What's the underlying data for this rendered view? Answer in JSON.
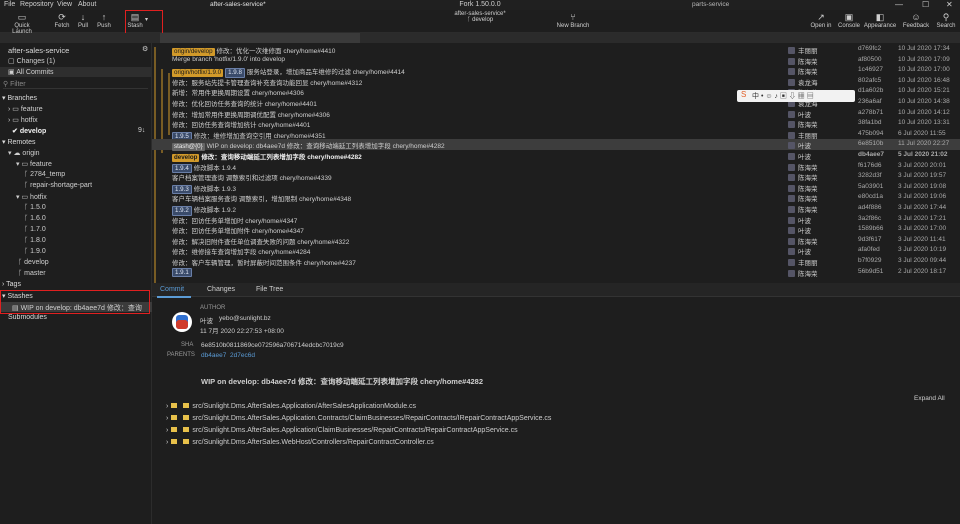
{
  "menu": [
    "File",
    "Repository",
    "View",
    "About"
  ],
  "title": "Fork 1.50.0.0",
  "window_controls": [
    "—",
    "☐",
    "✕"
  ],
  "toolbar": {
    "quick_launch": "Quick Launch",
    "fetch": "Fetch",
    "pull": "Pull",
    "push": "Push",
    "stash": "Stash",
    "repo_name": "after-sales-service*",
    "branch": "develop",
    "new_branch": "New Branch",
    "open_in": "Open in",
    "console": "Console",
    "appearance": "Appearance",
    "feedback": "Feedback",
    "search": "Search"
  },
  "tabs": [
    "after-sales-service*",
    "parts-service"
  ],
  "sidebar": {
    "repo": "after-sales-service",
    "changes": "Changes (1)",
    "all_commits": "All Commits",
    "filter": "Filter",
    "branches": "Branches",
    "feature": "feature",
    "hotfix": "hotfix",
    "develop": "develop",
    "develop_badge": "9↓",
    "remotes": "Remotes",
    "origin": "origin",
    "r_feature": "feature",
    "f1": "2784_temp",
    "f2": "repair-shortage-part",
    "r_hotfix": "hotfix",
    "h1": "1.5.0",
    "h2": "1.6.0",
    "h3": "1.7.0",
    "h4": "1.8.0",
    "h5": "1.9.0",
    "r_develop": "develop",
    "r_master": "master",
    "tags": "Tags",
    "stashes": "Stashes",
    "stash_item": "WIP on develop: db4aee7d 修改：查询",
    "submodules": "Submodules"
  },
  "commits": [
    {
      "tags": [
        {
          "t": "origin/develop",
          "k": "branch"
        }
      ],
      "msg": "修改：优化一次维修面 chery/home#4410",
      "author": "丰丽丽",
      "sha": "d769fc2",
      "date": "10 Jul 2020 17:34",
      "bold": false,
      "sel": false
    },
    {
      "tags": [],
      "msg": "Merge branch 'hotfix/1.9.0' into develop",
      "author": "陈海荣",
      "sha": "af80500",
      "date": "10 Jul 2020 17:09",
      "bold": false,
      "sel": false
    },
    {
      "tags": [
        {
          "t": "origin/hotfix/1.9.0",
          "k": "branch"
        },
        {
          "t": "1.9.8",
          "k": "ver"
        }
      ],
      "msg": "服务站登录，增加商品车维修的过滤 chery/home#4414",
      "author": "陈海荣",
      "sha": "1c46927",
      "date": "10 Jul 2020 17:00",
      "bold": false,
      "sel": false
    },
    {
      "tags": [],
      "msg": "修改：服务站先提卡管理查询补充查询功能回显 chery/home#4312",
      "author": "袁龙海",
      "sha": "802afc5",
      "date": "10 Jul 2020 16:48",
      "bold": false,
      "sel": false
    },
    {
      "tags": [],
      "msg": "新增：常用件更换周期设置 chery/home#4306",
      "author": "陈海荣",
      "sha": "d1a602b",
      "date": "10 Jul 2020 15:21",
      "bold": false,
      "sel": false
    },
    {
      "tags": [],
      "msg": "修改：优化回访任务查询的统计 chery/home#4401",
      "author": "袁龙海",
      "sha": "236a6af",
      "date": "10 Jul 2020 14:38",
      "bold": false,
      "sel": false
    },
    {
      "tags": [],
      "msg": "修改：增加常用件更换周期调优配置 chery/home#4306",
      "author": "叶波",
      "sha": "a278b71",
      "date": "10 Jul 2020 14:12",
      "bold": false,
      "sel": false
    },
    {
      "tags": [],
      "msg": "修改：回访任务查询增加统计 chery/home#4401",
      "author": "陈海荣",
      "sha": "38fa1bd",
      "date": "10 Jul 2020 13:31",
      "bold": false,
      "sel": false
    },
    {
      "tags": [
        {
          "t": "1.9.5",
          "k": "ver"
        }
      ],
      "msg": "修改：维修增加查询空引用 chery/home#4351",
      "author": "丰丽丽",
      "sha": "475b094",
      "date": "6 Jul 2020 11:55",
      "bold": false,
      "sel": false
    },
    {
      "tags": [
        {
          "t": "stash@{0}",
          "k": "stash"
        }
      ],
      "msg": "WIP on develop: db4aee7d 修改：查询移动端延工列表增加字段 chery/home#4282",
      "author": "叶波",
      "sha": "6e8510b",
      "date": "11 Jul 2020 22:27",
      "bold": false,
      "sel": true
    },
    {
      "tags": [
        {
          "t": "develop",
          "k": "branch"
        }
      ],
      "msg": "修改：查询移动端延工列表增加字段 chery/home#4282",
      "author": "叶波",
      "sha": "db4aee7",
      "date": "5 Jul 2020 21:02",
      "bold": true,
      "sel": false
    },
    {
      "tags": [
        {
          "t": "1.9.4",
          "k": "ver"
        }
      ],
      "msg": "修改脚本 1.9.4",
      "author": "陈海荣",
      "sha": "f6176d6",
      "date": "3 Jul 2020 20:01",
      "bold": false,
      "sel": false
    },
    {
      "tags": [],
      "msg": "客户档案管理查询 调整索引和过滤项 chery/home#4339",
      "author": "陈海荣",
      "sha": "3282d3f",
      "date": "3 Jul 2020 19:57",
      "bold": false,
      "sel": false
    },
    {
      "tags": [
        {
          "t": "1.9.3",
          "k": "ver"
        }
      ],
      "msg": "修改脚本 1.9.3",
      "author": "陈海荣",
      "sha": "5a03901",
      "date": "3 Jul 2020 19:08",
      "bold": false,
      "sel": false
    },
    {
      "tags": [],
      "msg": "客户车辆档案服务查询 调整索引，增加限制 chery/home#4348",
      "author": "陈海荣",
      "sha": "e80cd1a",
      "date": "3 Jul 2020 19:06",
      "bold": false,
      "sel": false
    },
    {
      "tags": [
        {
          "t": "1.9.2",
          "k": "ver"
        }
      ],
      "msg": "修改脚本 1.9.2",
      "author": "陈海荣",
      "sha": "ad4f886",
      "date": "3 Jul 2020 17:44",
      "bold": false,
      "sel": false
    },
    {
      "tags": [],
      "msg": "修改：回访任务单增加时 chery/home#4347",
      "author": "叶波",
      "sha": "3a2f86c",
      "date": "3 Jul 2020 17:21",
      "bold": false,
      "sel": false
    },
    {
      "tags": [],
      "msg": "修改：回访任务单增加附件 chery/home#4347",
      "author": "叶波",
      "sha": "1589b66",
      "date": "3 Jul 2020 17:00",
      "bold": false,
      "sel": false
    },
    {
      "tags": [],
      "msg": "修改：解决旧附件查任单位调查失败的问题 chery/home#4322",
      "author": "陈海荣",
      "sha": "9d3f617",
      "date": "3 Jul 2020 11:41",
      "bold": false,
      "sel": false
    },
    {
      "tags": [],
      "msg": "修改：维修接车查询增加字段 chery/home#4284",
      "author": "叶波",
      "sha": "afa0fed",
      "date": "3 Jul 2020 10:19",
      "bold": false,
      "sel": false
    },
    {
      "tags": [],
      "msg": "修改：客户车辆管理，暂时屏蔽时间范围条件 chery/home#4237",
      "author": "丰丽丽",
      "sha": "b7f0929",
      "date": "3 Jul 2020 09:44",
      "bold": false,
      "sel": false
    },
    {
      "tags": [
        {
          "t": "1.9.1",
          "k": "ver"
        }
      ],
      "msg": "",
      "author": "陈海荣",
      "sha": "56b9d51",
      "date": "2 Jul 2020 18:17",
      "bold": false,
      "sel": false
    }
  ],
  "details": {
    "tabs": [
      "Commit",
      "Changes",
      "File Tree"
    ],
    "author_label": "AUTHOR",
    "author_name": "叶波",
    "author_email": "yebo@sunlight.bz",
    "author_date": "11 7月 2020 22:27:53 +08:00",
    "sha_label": "SHA",
    "sha": "6e8510b0811869ce072596a706714edcbc7019c9",
    "parents_label": "PARENTS",
    "parent1": "db4aee7",
    "parent2": "2d7ec6d",
    "message": "WIP on develop: db4aee7d 修改：查询移动端延工列表增加字段 chery/home#4282",
    "expand_all": "Expand All",
    "files": [
      "src/Sunlight.Dms.AfterSales.Application/AfterSalesApplicationModule.cs",
      "src/Sunlight.Dms.AfterSales.Application.Contracts/ClaimBusinesses/RepairContracts/IRepairContractAppService.cs",
      "src/Sunlight.Dms.AfterSales.Application/ClaimBusinesses/RepairContracts/RepairContractAppService.cs",
      "src/Sunlight.Dms.AfterSales.WebHost/Controllers/RepairContractController.cs"
    ]
  }
}
